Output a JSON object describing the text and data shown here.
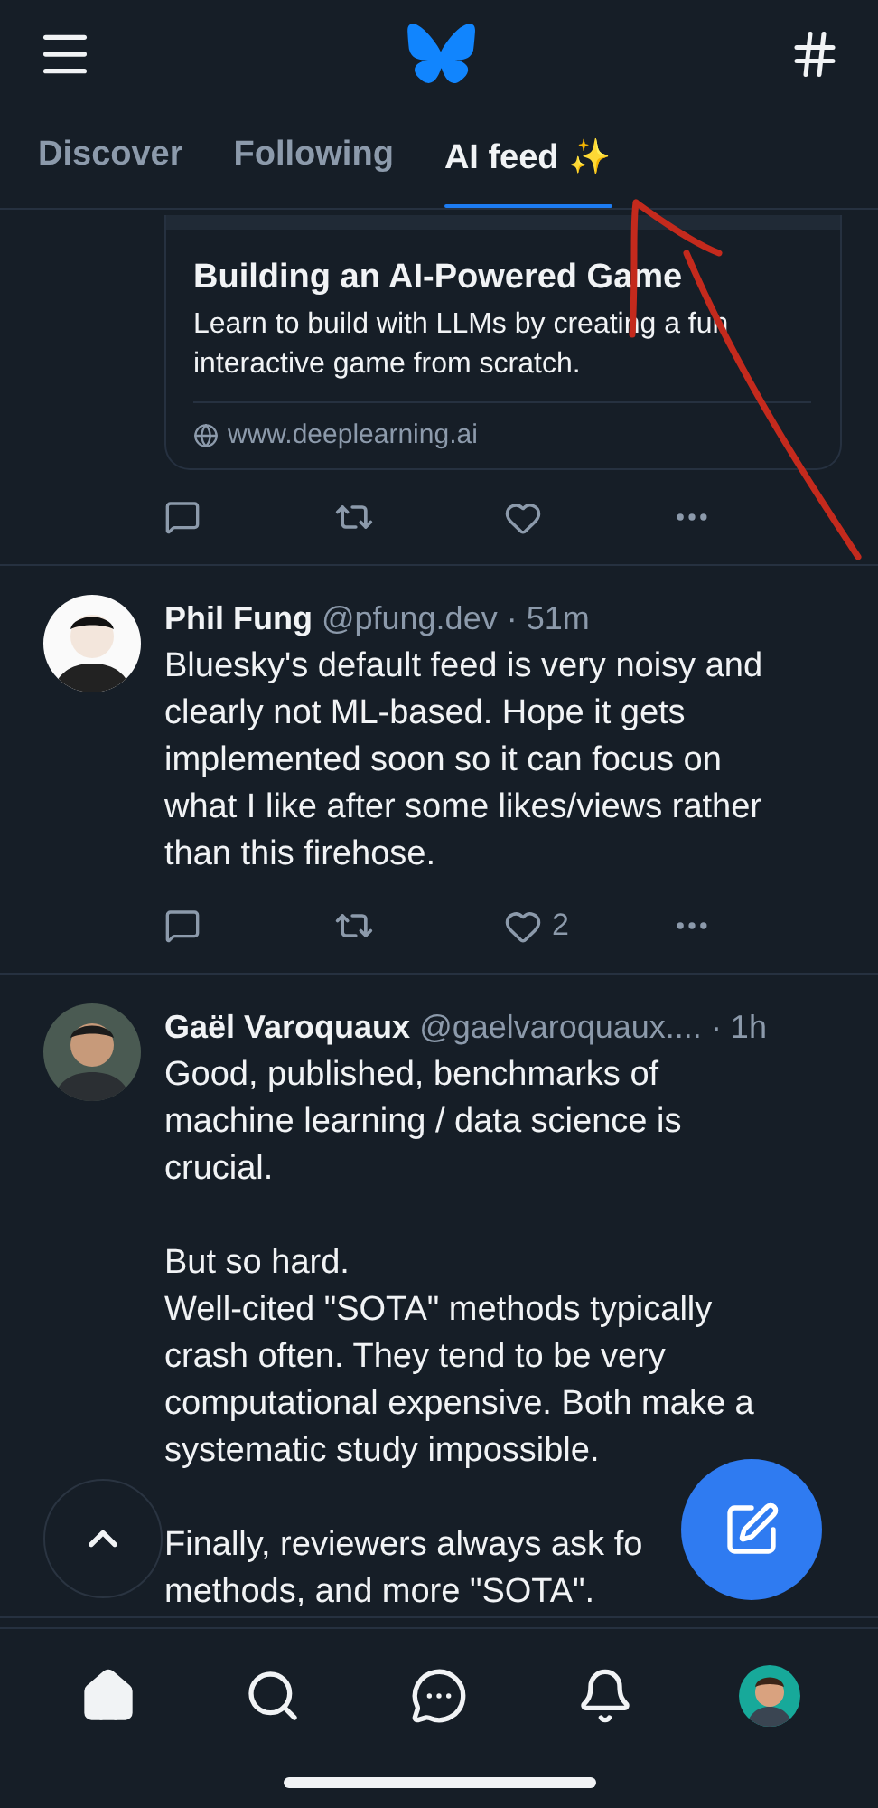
{
  "tabs": [
    {
      "label": "Discover",
      "selected": false
    },
    {
      "label": "Following",
      "selected": false
    },
    {
      "label": "AI feed ✨",
      "selected": true
    }
  ],
  "feed": [
    {
      "kind": "embed",
      "card": {
        "title": "Building an AI-Powered Game",
        "description": "Learn to build with LLMs by creating a fun interactive game from scratch.",
        "domain": "www.deeplearning.ai"
      },
      "actions": true
    },
    {
      "kind": "post",
      "author": "Phil Fung",
      "handle": "@pfung.dev",
      "time": "· 51m",
      "paragraphs": [
        "Bluesky's default feed is very noisy and\nclearly not ML-based. Hope it gets\nimplemented soon so it can focus on\nwhat I like after some likes/views rather\nthan this firehose."
      ],
      "like_count": "2",
      "actions": true
    },
    {
      "kind": "post",
      "author": "Gaël Varoquaux",
      "handle": "@gaelvaroquaux....",
      "time": "· 1h",
      "paragraphs": [
        "Good, published, benchmarks of\nmachine learning / data science is\ncrucial.",
        "But so hard.\nWell-cited \"SOTA\" methods typically\ncrash often. They tend to be very\ncomputational expensive. Both make a\nsystematic study impossible.",
        "Finally, reviewers always ask fo\nmethods, and more \"SOTA\"."
      ],
      "actions": false
    }
  ],
  "bottom_nav": [
    {
      "kind": "home",
      "selected": true
    },
    {
      "kind": "search",
      "selected": false
    },
    {
      "kind": "chat",
      "selected": false
    },
    {
      "kind": "bell",
      "selected": false
    },
    {
      "kind": "profile",
      "selected": false
    }
  ]
}
